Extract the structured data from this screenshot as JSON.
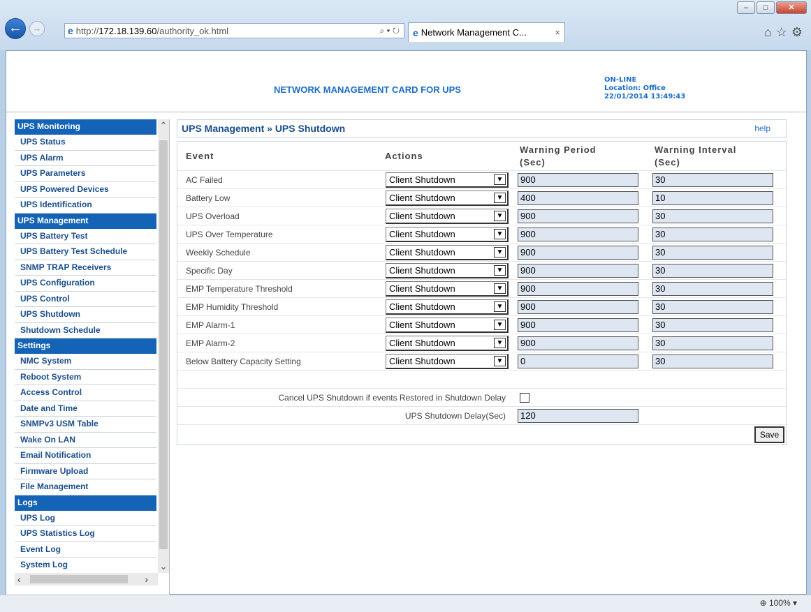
{
  "browser": {
    "url_prefix": "http://",
    "url_host": "172.18.139.60",
    "url_path": "/authority_ok.html",
    "tab_title": "Network Management C...",
    "tab_close": "×",
    "zoom": "100%"
  },
  "header": {
    "title": "NETWORK MANAGEMENT CARD FOR UPS",
    "status": "ON-LINE",
    "location": "Location: Office",
    "datetime": "22/01/2014 13:49:43"
  },
  "sidebar": {
    "sections": [
      {
        "title": "UPS Monitoring",
        "items": [
          "UPS Status",
          "UPS Alarm",
          "UPS Parameters",
          "UPS Powered Devices",
          "UPS Identification"
        ]
      },
      {
        "title": "UPS Management",
        "items": [
          "UPS Battery Test",
          "UPS Battery Test Schedule",
          "SNMP TRAP Receivers",
          "UPS Configuration",
          "UPS Control",
          "UPS Shutdown",
          "Shutdown Schedule"
        ]
      },
      {
        "title": "Settings",
        "items": [
          "NMC System",
          "Reboot System",
          "Access Control",
          "Date and Time",
          "SNMPv3 USM Table",
          "Wake On LAN",
          "Email Notification",
          "Firmware Upload",
          "File Management"
        ]
      },
      {
        "title": "Logs",
        "items": [
          "UPS Log",
          "UPS Statistics Log",
          "Event Log",
          "System Log"
        ]
      }
    ]
  },
  "main": {
    "title": "UPS Management » UPS Shutdown",
    "help": "help",
    "headers": {
      "event": "Event",
      "actions": "Actions",
      "period_1": "Warning Period",
      "period_2": "(Sec)",
      "interval_1": "Warning Interval",
      "interval_2": "(Sec)"
    },
    "rows": [
      {
        "event": "AC Failed",
        "action": "Client Shutdown",
        "period": "900",
        "interval": "30"
      },
      {
        "event": "Battery Low",
        "action": "Client Shutdown",
        "period": "400",
        "interval": "10"
      },
      {
        "event": "UPS Overload",
        "action": "Client Shutdown",
        "period": "900",
        "interval": "30"
      },
      {
        "event": "UPS Over Temperature",
        "action": "Client Shutdown",
        "period": "900",
        "interval": "30"
      },
      {
        "event": "Weekly Schedule",
        "action": "Client Shutdown",
        "period": "900",
        "interval": "30"
      },
      {
        "event": "Specific Day",
        "action": "Client Shutdown",
        "period": "900",
        "interval": "30"
      },
      {
        "event": "EMP Temperature Threshold",
        "action": "Client Shutdown",
        "period": "900",
        "interval": "30"
      },
      {
        "event": "EMP Humidity Threshold",
        "action": "Client Shutdown",
        "period": "900",
        "interval": "30"
      },
      {
        "event": "EMP Alarm-1",
        "action": "Client Shutdown",
        "period": "900",
        "interval": "30"
      },
      {
        "event": "EMP Alarm-2",
        "action": "Client Shutdown",
        "period": "900",
        "interval": "30"
      },
      {
        "event": "Below Battery Capacity Setting",
        "action": "Client Shutdown",
        "period": "0",
        "interval": "30"
      }
    ],
    "cancel_label": "Cancel UPS Shutdown if events Restored in Shutdown Delay",
    "cancel_checked": false,
    "delay_label": "UPS Shutdown Delay(Sec)",
    "delay_value": "120",
    "save_label": "Save"
  }
}
